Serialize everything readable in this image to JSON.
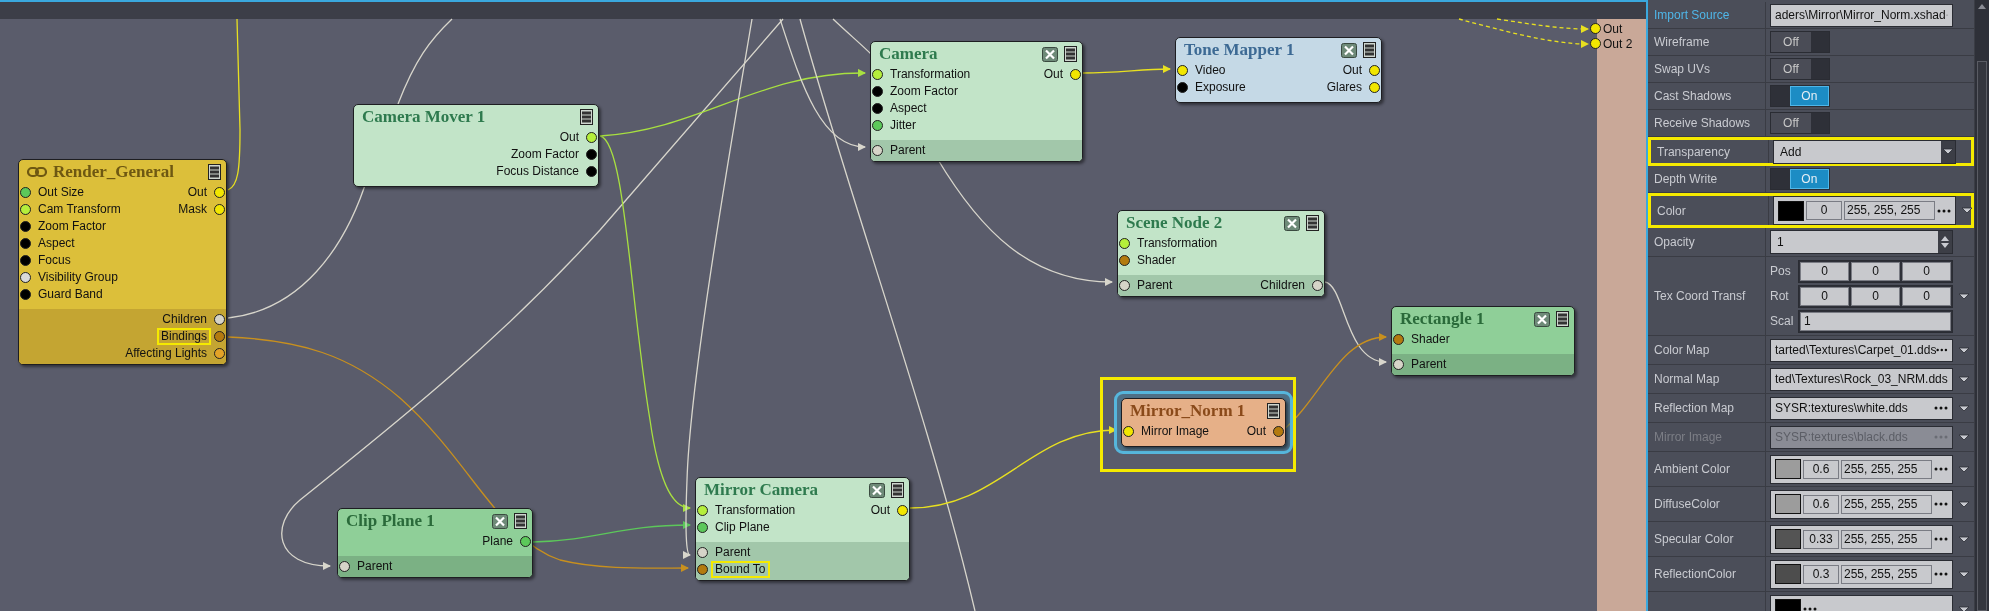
{
  "graph": {
    "nodes": [
      {
        "title": "Render_General",
        "kind": "render",
        "linked": true,
        "closable": false,
        "highlighted": false,
        "inputs": [
          {
            "label": "Out Size",
            "color": "#5cc85a",
            "highlighted": false
          },
          {
            "label": "Cam Transform",
            "color": "#b5ef3b",
            "highlighted": false
          },
          {
            "label": "Zoom Factor",
            "color": "#000000",
            "highlighted": false
          },
          {
            "label": "Aspect",
            "color": "#000000",
            "highlighted": false
          },
          {
            "label": "Focus",
            "color": "#000000",
            "highlighted": false
          },
          {
            "label": "Visibility Group",
            "color": "#d9d9d9",
            "highlighted": false
          },
          {
            "label": "Guard Band",
            "color": "#000000",
            "highlighted": false
          }
        ],
        "outputs": [
          {
            "label": "Out",
            "color": "#f2e600",
            "highlighted": false
          },
          {
            "label": "Mask",
            "color": "#f2e600",
            "highlighted": false
          }
        ],
        "footer_outputs": [
          {
            "label": "Children",
            "color": "#d6d4c8",
            "highlighted": false
          },
          {
            "label": "Bindings",
            "color": "#b37a0f",
            "highlighted": true
          },
          {
            "label": "Affecting Lights",
            "color": "#e3a327",
            "highlighted": false
          }
        ]
      },
      {
        "title": "Camera Mover 1",
        "kind": "scene",
        "linked": false,
        "closable": false,
        "highlighted": false,
        "outputs": [
          {
            "label": "Out",
            "color": "#b5ef3b",
            "highlighted": false
          },
          {
            "label": "Zoom Factor",
            "color": "#000000",
            "highlighted": false
          },
          {
            "label": "Focus Distance",
            "color": "#000000",
            "highlighted": false
          }
        ]
      },
      {
        "title": "Camera",
        "kind": "scene",
        "linked": false,
        "closable": true,
        "highlighted": false,
        "inputs": [
          {
            "label": "Transformation",
            "color": "#b5ef3b",
            "highlighted": false
          },
          {
            "label": "Zoom Factor",
            "color": "#000000",
            "highlighted": false
          },
          {
            "label": "Aspect",
            "color": "#000000",
            "highlighted": false
          },
          {
            "label": "Jitter",
            "color": "#5cc85a",
            "highlighted": false
          }
        ],
        "outputs": [
          {
            "label": "Out",
            "color": "#f2e600",
            "highlighted": false
          }
        ],
        "footer_inputs": [
          {
            "label": "Parent",
            "color": "#d6d4c8",
            "highlighted": false
          }
        ]
      },
      {
        "title": "Tone Mapper 1",
        "kind": "post",
        "linked": false,
        "closable": true,
        "highlighted": false,
        "inputs": [
          {
            "label": "Video",
            "color": "#f2e600",
            "highlighted": false
          },
          {
            "label": "Exposure",
            "color": "#000000",
            "highlighted": false
          }
        ],
        "outputs": [
          {
            "label": "Out",
            "color": "#f2e600",
            "highlighted": false
          },
          {
            "label": "Glares",
            "color": "#f2e600",
            "highlighted": false
          }
        ]
      },
      {
        "title": "Scene Node 2",
        "kind": "scene",
        "linked": false,
        "closable": true,
        "highlighted": false,
        "inputs": [
          {
            "label": "Transformation",
            "color": "#b5ef3b",
            "highlighted": false
          },
          {
            "label": "Shader",
            "color": "#b37a0f",
            "highlighted": false
          }
        ],
        "footer_inputs": [
          {
            "label": "Parent",
            "color": "#d6d4c8",
            "highlighted": false
          }
        ],
        "footer_outputs": [
          {
            "label": "Children",
            "color": "#d6d4c8",
            "highlighted": false
          }
        ]
      },
      {
        "title": "Rectangle 1",
        "kind": "geometry",
        "linked": false,
        "closable": true,
        "highlighted": false,
        "inputs": [
          {
            "label": "Shader",
            "color": "#b37a0f",
            "highlighted": false
          }
        ],
        "footer_inputs": [
          {
            "label": "Parent",
            "color": "#d6d4c8",
            "highlighted": false
          }
        ]
      },
      {
        "title": "Mirror_Norm 1",
        "kind": "shader",
        "linked": false,
        "closable": false,
        "highlighted": true,
        "inputs": [
          {
            "label": "Mirror Image",
            "color": "#f2e600",
            "highlighted": false
          }
        ],
        "outputs": [
          {
            "label": "Out",
            "color": "#b37a0f",
            "highlighted": false
          }
        ]
      },
      {
        "title": "Clip Plane 1",
        "kind": "geometry",
        "linked": false,
        "closable": true,
        "highlighted": false,
        "outputs": [
          {
            "label": "Plane",
            "color": "#5cc85a",
            "highlighted": false
          }
        ],
        "footer_inputs": [
          {
            "label": "Parent",
            "color": "#d6d4c8",
            "highlighted": false
          }
        ]
      },
      {
        "title": "Mirror Camera",
        "kind": "scene",
        "linked": false,
        "closable": true,
        "highlighted": false,
        "inputs": [
          {
            "label": "Transformation",
            "color": "#b5ef3b",
            "highlighted": false
          },
          {
            "label": "Clip Plane",
            "color": "#5cc85a",
            "highlighted": false
          }
        ],
        "outputs": [
          {
            "label": "Out",
            "color": "#f2e600",
            "highlighted": false
          }
        ],
        "footer_inputs": [
          {
            "label": "Parent",
            "color": "#d6d4c8",
            "highlighted": false
          },
          {
            "label": "Bound To",
            "color": "#b37a0f",
            "highlighted": true
          }
        ]
      }
    ],
    "clipped_node": {
      "ports": [
        {
          "label": "Out",
          "color": "#f2e600"
        },
        {
          "label": "Out 2",
          "color": "#f2e600"
        }
      ]
    }
  },
  "properties": {
    "rows": [
      {
        "kind": "path",
        "label": "Import Source",
        "selected": true,
        "highlighted": false,
        "disabled": false,
        "expandable": false,
        "value": "aders\\Mirror\\Mirror_Norm.xshad"
      },
      {
        "kind": "toggle",
        "label": "Wireframe",
        "selected": false,
        "highlighted": false,
        "on": false,
        "value": "Off"
      },
      {
        "kind": "toggle",
        "label": "Swap UVs",
        "selected": false,
        "highlighted": false,
        "on": false,
        "value": "Off"
      },
      {
        "kind": "toggle",
        "label": "Cast Shadows",
        "selected": false,
        "highlighted": false,
        "on": true,
        "value": "On"
      },
      {
        "kind": "toggle",
        "label": "Receive Shadows",
        "selected": false,
        "highlighted": false,
        "on": false,
        "value": "Off"
      },
      {
        "kind": "dropdown",
        "label": "Transparency",
        "selected": false,
        "highlighted": true,
        "value": "Add"
      },
      {
        "kind": "toggle",
        "label": "Depth Write",
        "selected": false,
        "highlighted": false,
        "on": true,
        "value": "On"
      },
      {
        "kind": "color",
        "label": "Color",
        "selected": false,
        "highlighted": true,
        "color": "#000000",
        "amount": "0",
        "rgb": "255, 255, 255"
      },
      {
        "kind": "number",
        "label": "Opacity",
        "selected": false,
        "highlighted": false,
        "value": "1"
      },
      {
        "kind": "transform",
        "label": "Tex Coord Transf",
        "selected": false,
        "highlighted": false,
        "fields": [
          {
            "label": "Pos",
            "values": [
              "0",
              "0",
              "0"
            ]
          },
          {
            "label": "Rot",
            "values": [
              "0",
              "0",
              "0"
            ]
          },
          {
            "label": "Scal",
            "values": [
              "1"
            ]
          }
        ]
      },
      {
        "kind": "path",
        "label": "Color Map",
        "selected": false,
        "highlighted": false,
        "disabled": false,
        "expandable": true,
        "value": "tarted\\Textures\\Carpet_01.dds"
      },
      {
        "kind": "path",
        "label": "Normal Map",
        "selected": false,
        "highlighted": false,
        "disabled": false,
        "expandable": true,
        "value": "ted\\Textures\\Rock_03_NRM.dds"
      },
      {
        "kind": "path",
        "label": "Reflection Map",
        "selected": false,
        "highlighted": false,
        "disabled": false,
        "expandable": true,
        "value": "SYSR:textures\\white.dds"
      },
      {
        "kind": "path",
        "label": "Mirror Image",
        "selected": false,
        "highlighted": false,
        "disabled": true,
        "expandable": true,
        "value": "SYSR:textures\\black.dds"
      },
      {
        "kind": "color",
        "label": "Ambient Color",
        "selected": false,
        "highlighted": false,
        "color": "#9c9c9c",
        "amount": "0.6",
        "rgb": "255, 255, 255"
      },
      {
        "kind": "color",
        "label": "DiffuseColor",
        "selected": false,
        "highlighted": false,
        "color": "#9c9c9c",
        "amount": "0.6",
        "rgb": "255, 255, 255"
      },
      {
        "kind": "color",
        "label": "Specular Color",
        "selected": false,
        "highlighted": false,
        "color": "#545454",
        "amount": "0.33",
        "rgb": "255, 255, 255"
      },
      {
        "kind": "color",
        "label": "ReflectionColor",
        "selected": false,
        "highlighted": false,
        "color": "#4d4d4d",
        "amount": "0.3",
        "rgb": "255, 255, 255"
      },
      {
        "kind": "color",
        "highlighted": false,
        "color": "#000000"
      }
    ]
  }
}
